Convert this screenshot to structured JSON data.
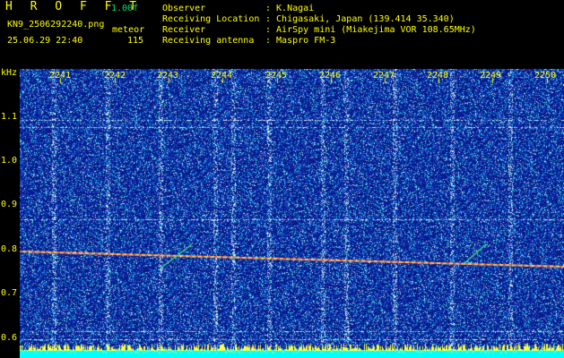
{
  "header": {
    "title": "H R O F F T",
    "version": "1.00f",
    "filename": "KN9_2506292240.png",
    "datetime": "25.06.29 22:40",
    "mode_label": "meteor",
    "count": "115",
    "observer_label": "Observer",
    "observer_value": ": K.Nagai",
    "location_label": "Receiving Location",
    "location_value": ": Chigasaki, Japan (139.414 35.340)",
    "receiver_label": "Receiver",
    "receiver_value": ": AirSpy mini (Miakejima VOR 108.65MHz)",
    "antenna_label": "Receiving antenna",
    "antenna_value": ": Maspro FM-3"
  },
  "axis": {
    "y_unit": "kHz",
    "y_ticks": [
      "1.1",
      "1.0",
      "0.9",
      "0.8",
      "0.7",
      "0.6"
    ],
    "x_ticks": [
      "2241",
      "2242",
      "2243",
      "2244",
      "2245",
      "2246",
      "2247",
      "2248",
      "2249",
      "2250"
    ]
  },
  "colors": {
    "background": "#000000",
    "spectrogram_base": "#0a1a8c",
    "text": "#ffff00",
    "signal": "#ff6040",
    "bar": "#00ffff"
  }
}
